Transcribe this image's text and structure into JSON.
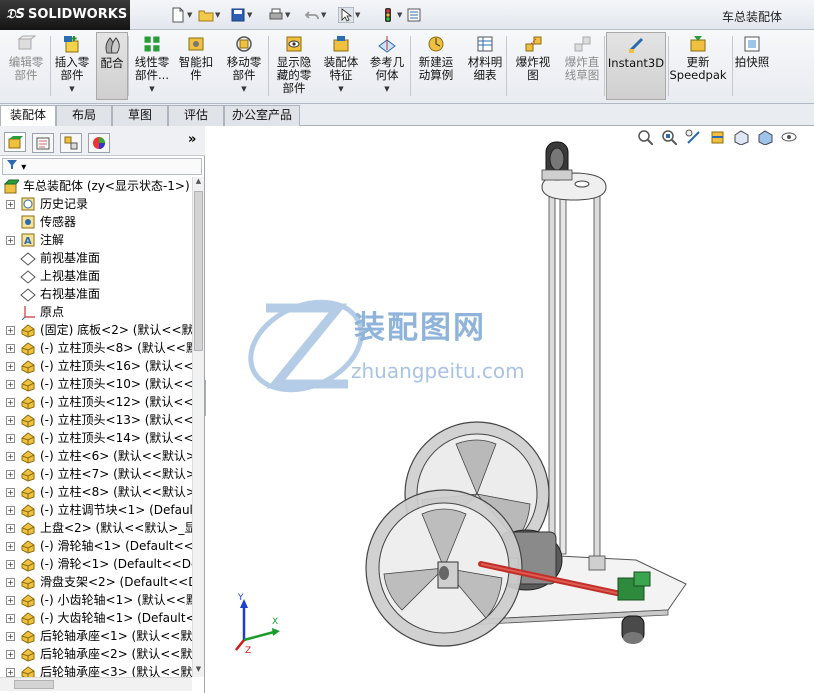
{
  "app": {
    "name": "SOLIDWORKS",
    "document_title": "车总装配体"
  },
  "quick_access": [
    {
      "icon": "new-document-icon"
    },
    {
      "icon": "open-folder-icon"
    },
    {
      "icon": "save-icon"
    },
    {
      "icon": "print-icon"
    },
    {
      "icon": "undo-icon"
    },
    {
      "icon": "select-arrow-icon"
    },
    {
      "icon": "traffic-light-icon"
    },
    {
      "icon": "options-icon"
    }
  ],
  "ribbon": {
    "buttons": [
      {
        "label_1": "编辑零",
        "label_2": "部件",
        "label_3": "",
        "icon": "edit-component-icon",
        "enabled": false,
        "dropdown": false
      },
      {
        "label_1": "插入零",
        "label_2": "部件",
        "label_3": "",
        "icon": "insert-component-icon",
        "enabled": true,
        "dropdown": true
      },
      {
        "label_1": "配合",
        "label_2": "",
        "label_3": "",
        "icon": "mate-icon",
        "enabled": true,
        "dropdown": false,
        "active": true
      },
      {
        "label_1": "线性零",
        "label_2": "部件...",
        "label_3": "",
        "icon": "linear-pattern-icon",
        "enabled": true,
        "dropdown": true
      },
      {
        "label_1": "智能扣",
        "label_2": "件",
        "label_3": "",
        "icon": "smart-fastener-icon",
        "enabled": true,
        "dropdown": false
      },
      {
        "label_1": "移动零",
        "label_2": "部件",
        "label_3": "",
        "icon": "move-component-icon",
        "enabled": true,
        "dropdown": true
      },
      {
        "label_1": "显示隐",
        "label_2": "藏的零",
        "label_3": "部件",
        "icon": "show-hidden-icon",
        "enabled": true,
        "dropdown": false
      },
      {
        "label_1": "装配体",
        "label_2": "特征",
        "label_3": "",
        "icon": "assembly-feature-icon",
        "enabled": true,
        "dropdown": true
      },
      {
        "label_1": "参考几",
        "label_2": "何体",
        "label_3": "",
        "icon": "reference-geometry-icon",
        "enabled": true,
        "dropdown": true
      },
      {
        "label_1": "新建运",
        "label_2": "动算例",
        "label_3": "",
        "icon": "motion-study-icon",
        "enabled": true,
        "dropdown": false
      },
      {
        "label_1": "材料明",
        "label_2": "细表",
        "label_3": "",
        "icon": "bom-icon",
        "enabled": true,
        "dropdown": false
      },
      {
        "label_1": "爆炸视",
        "label_2": "图",
        "label_3": "",
        "icon": "exploded-view-icon",
        "enabled": true,
        "dropdown": false
      },
      {
        "label_1": "爆炸直",
        "label_2": "线草图",
        "label_3": "",
        "icon": "explode-line-sketch-icon",
        "enabled": false,
        "dropdown": false
      },
      {
        "label_1": "Instant3D",
        "label_2": "",
        "label_3": "",
        "icon": "instant3d-icon",
        "enabled": true,
        "dropdown": false,
        "active": true
      },
      {
        "label_1": "更新",
        "label_2": "Speedpak",
        "label_3": "",
        "icon": "speedpak-icon",
        "enabled": true,
        "dropdown": false
      },
      {
        "label_1": "拍快照",
        "label_2": "",
        "label_3": "",
        "icon": "snapshot-icon",
        "enabled": true,
        "dropdown": false
      }
    ]
  },
  "tabs": [
    "装配体",
    "布局",
    "草图",
    "评估",
    "办公室产品"
  ],
  "active_tab": "装配体",
  "panel_tabs": [
    {
      "icon": "feature-manager-icon"
    },
    {
      "icon": "property-manager-icon"
    },
    {
      "icon": "configuration-manager-icon"
    },
    {
      "icon": "display-manager-icon"
    }
  ],
  "panel_collapse": "»",
  "filter": {
    "label": "▾"
  },
  "tree": [
    {
      "label": "车总装配体 (zy<显示状态-1>)",
      "icon": "assembly-icon",
      "level": 0,
      "expander": ""
    },
    {
      "label": "历史记录",
      "icon": "history-icon",
      "level": 1,
      "expander": "+"
    },
    {
      "label": "传感器",
      "icon": "sensor-icon",
      "level": 1,
      "expander": ""
    },
    {
      "label": "注解",
      "icon": "annotation-icon",
      "level": 1,
      "expander": "+"
    },
    {
      "label": "前视基准面",
      "icon": "plane-icon",
      "level": 1,
      "expander": ""
    },
    {
      "label": "上视基准面",
      "icon": "plane-icon",
      "level": 1,
      "expander": ""
    },
    {
      "label": "右视基准面",
      "icon": "plane-icon",
      "level": 1,
      "expander": ""
    },
    {
      "label": "原点",
      "icon": "origin-icon",
      "level": 1,
      "expander": ""
    },
    {
      "label": "(固定) 底板<2> (默认<<默",
      "icon": "part-icon",
      "level": 1,
      "expander": "+"
    },
    {
      "label": "(-) 立柱顶头<8> (默认<<默",
      "icon": "part-icon",
      "level": 1,
      "expander": "+"
    },
    {
      "label": "(-) 立柱顶头<16> (默认<<",
      "icon": "part-icon",
      "level": 1,
      "expander": "+"
    },
    {
      "label": "(-) 立柱顶头<10> (默认<<",
      "icon": "part-icon",
      "level": 1,
      "expander": "+"
    },
    {
      "label": "(-) 立柱顶头<12> (默认<<",
      "icon": "part-icon",
      "level": 1,
      "expander": "+"
    },
    {
      "label": "(-) 立柱顶头<13> (默认<<",
      "icon": "part-icon",
      "level": 1,
      "expander": "+"
    },
    {
      "label": "(-) 立柱顶头<14> (默认<<",
      "icon": "part-icon",
      "level": 1,
      "expander": "+"
    },
    {
      "label": "(-) 立柱<6> (默认<<默认>",
      "icon": "part-icon",
      "level": 1,
      "expander": "+"
    },
    {
      "label": "(-) 立柱<7> (默认<<默认>",
      "icon": "part-icon",
      "level": 1,
      "expander": "+"
    },
    {
      "label": "(-) 立柱<8> (默认<<默认>",
      "icon": "part-icon",
      "level": 1,
      "expander": "+"
    },
    {
      "label": "(-) 立柱调节块<1> (Defaul",
      "icon": "part-icon",
      "level": 1,
      "expander": "+"
    },
    {
      "label": "上盘<2> (默认<<默认>_显",
      "icon": "part-icon",
      "level": 1,
      "expander": "+"
    },
    {
      "label": "(-) 滑轮轴<1> (Default<<[",
      "icon": "part-icon",
      "level": 1,
      "expander": "+"
    },
    {
      "label": "(-) 滑轮<1> (Default<<De",
      "icon": "part-icon",
      "level": 1,
      "expander": "+"
    },
    {
      "label": "滑盘支架<2> (Default<<D",
      "icon": "part-icon",
      "level": 1,
      "expander": "+"
    },
    {
      "label": "(-) 小齿轮轴<1> (默认<<默",
      "icon": "part-icon",
      "level": 1,
      "expander": "+"
    },
    {
      "label": "(-) 大齿轮轴<1> (Default<",
      "icon": "part-icon",
      "level": 1,
      "expander": "+"
    },
    {
      "label": "后轮轴承座<1> (默认<<默",
      "icon": "part-icon",
      "level": 1,
      "expander": "+"
    },
    {
      "label": "后轮轴承座<2> (默认<<默",
      "icon": "part-icon",
      "level": 1,
      "expander": "+"
    },
    {
      "label": "后轮轴承座<3> (默认<<默",
      "icon": "part-icon",
      "level": 1,
      "expander": "+"
    }
  ],
  "view_toolbar": [
    {
      "icon": "zoom-to-fit-icon"
    },
    {
      "icon": "zoom-to-area-icon"
    },
    {
      "icon": "previous-view-icon"
    },
    {
      "icon": "section-view-icon"
    },
    {
      "icon": "view-orientation-icon"
    },
    {
      "icon": "display-style-icon"
    },
    {
      "icon": "hide-show-items-icon"
    }
  ],
  "watermark": {
    "cn": "装配图网",
    "en": "zhuangpeitu.com",
    "color": "#8fb3d9"
  },
  "triad": {
    "x": "X",
    "y": "Y",
    "z": "Z"
  }
}
